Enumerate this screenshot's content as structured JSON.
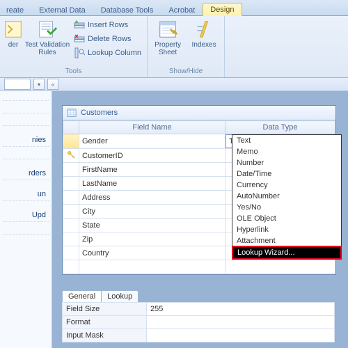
{
  "ribbon": {
    "tabs": [
      "reate",
      "External Data",
      "Database Tools",
      "Acrobat",
      "Design"
    ],
    "active_tab_index": 4,
    "groups": {
      "tools": {
        "label": "Tools",
        "builder": "der",
        "test_validation": "Test Validation\nRules",
        "insert_rows": "Insert Rows",
        "delete_rows": "Delete Rows",
        "lookup_column": "Lookup Column"
      },
      "showhide": {
        "label": "Show/Hide",
        "property_sheet": "Property\nSheet",
        "indexes": "Indexes"
      }
    }
  },
  "nav": {
    "items": [
      "",
      "",
      "",
      "nies",
      "",
      "rders",
      "un",
      "Upd",
      ""
    ]
  },
  "table_window": {
    "title": "Customers",
    "columns": {
      "field": "Field Name",
      "type": "Data Type"
    },
    "rows": [
      {
        "key": false,
        "name": "Gender"
      },
      {
        "key": true,
        "name": "CustomerID"
      },
      {
        "key": false,
        "name": "FirstName"
      },
      {
        "key": false,
        "name": "LastName"
      },
      {
        "key": false,
        "name": "Address"
      },
      {
        "key": false,
        "name": "City"
      },
      {
        "key": false,
        "name": "State"
      },
      {
        "key": false,
        "name": "Zip"
      },
      {
        "key": false,
        "name": "Country"
      }
    ],
    "active_row": 0,
    "datatype_value": "Text",
    "dropdown": [
      "Text",
      "Memo",
      "Number",
      "Date/Time",
      "Currency",
      "AutoNumber",
      "Yes/No",
      "OLE Object",
      "Hyperlink",
      "Attachment",
      "Lookup Wizard..."
    ],
    "dropdown_highlight": 10
  },
  "properties": {
    "tabs": [
      "General",
      "Lookup"
    ],
    "rows": [
      {
        "name": "Field Size",
        "value": "255"
      },
      {
        "name": "Format",
        "value": ""
      },
      {
        "name": "Input Mask",
        "value": ""
      }
    ]
  }
}
